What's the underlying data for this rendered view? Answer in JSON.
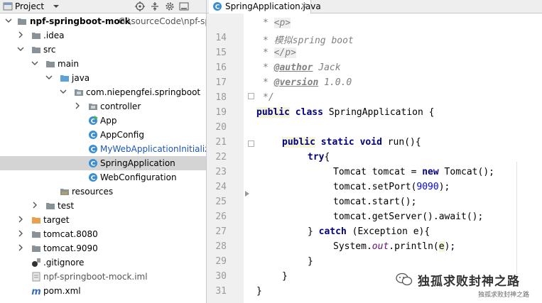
{
  "project_panel": {
    "title": "Project",
    "tree": [
      {
        "label": "npf-springboot-mock",
        "path": "G:\\sourceCode\\npf-springboot-mock",
        "icon": "folder-icon",
        "arrow": "expanded"
      },
      {
        "label": ".idea",
        "icon": "folder-icon",
        "arrow": "collapsed"
      },
      {
        "label": "src",
        "icon": "folder-icon",
        "arrow": "expanded"
      },
      {
        "label": "main",
        "icon": "folder-icon",
        "arrow": "expanded"
      },
      {
        "label": "java",
        "icon": "source-folder-icon",
        "arrow": "expanded"
      },
      {
        "label": "com.niepengfei.springboot",
        "icon": "package-icon",
        "arrow": "expanded"
      },
      {
        "label": "controller",
        "icon": "package-icon",
        "arrow": "collapsed"
      },
      {
        "label": "App",
        "icon": "runnable-class-icon",
        "arrow": "none"
      },
      {
        "label": "AppConfig",
        "icon": "class-icon",
        "arrow": "none"
      },
      {
        "label": "MyWebApplicationInitializer",
        "icon": "class-icon",
        "arrow": "none",
        "color": "#1a57b8"
      },
      {
        "label": "SpringApplication",
        "icon": "class-icon",
        "arrow": "none",
        "selected": true
      },
      {
        "label": "WebConfiguration",
        "icon": "class-icon",
        "arrow": "none"
      },
      {
        "label": "resources",
        "icon": "resources-folder-icon",
        "arrow": "none"
      },
      {
        "label": "test",
        "icon": "folder-icon",
        "arrow": "collapsed"
      },
      {
        "label": "target",
        "icon": "excluded-folder-icon",
        "arrow": "collapsed"
      },
      {
        "label": "tomcat.8080",
        "icon": "folder-icon",
        "arrow": "collapsed"
      },
      {
        "label": "tomcat.9090",
        "icon": "folder-icon",
        "arrow": "collapsed"
      },
      {
        "label": ".gitignore",
        "icon": "gitignore-icon",
        "arrow": "none"
      },
      {
        "label": "npf-springboot-mock.iml",
        "icon": "iml-file-icon",
        "arrow": "none",
        "color": "#555555"
      },
      {
        "label": "pom.xml",
        "icon": "maven-icon",
        "arrow": "none"
      }
    ]
  },
  "editor": {
    "tab_label": "SpringApplication.java",
    "line_numbers": [
      "14",
      "15",
      "16",
      "17",
      "18",
      "19",
      "20",
      "21",
      "22",
      "23",
      "24",
      "25",
      "26",
      "27",
      "28",
      "29",
      "30",
      "31"
    ],
    "code": {
      "l13": "* ",
      "l13_tag": "<p>",
      "l14": "* 模拟",
      "l14_b": "spring boot",
      "l15": "* ",
      "l15_tag": "</p>",
      "l16": "* ",
      "l16_tag": "@author",
      "l16_b": " Jack",
      "l17": "* ",
      "l17_tag": "@version",
      "l17_b": " 1.0.0",
      "l18": "*/",
      "l19_kw1": "public",
      "l19_kw2": "class",
      "l19_rest": " SpringApplication {",
      "l21_kw1": "public",
      "l21_kw2": "static",
      "l21_kw3": "void",
      "l21_rest": " run(){",
      "l22_kw": "try",
      "l22_rest": "{",
      "l23_a": "Tomcat tomcat = ",
      "l23_kw": "new",
      "l23_b": " Tomcat();",
      "l24_a": "tomcat.setPort(",
      "l24_num": "9090",
      "l24_b": ");",
      "l25": "tomcat.start();",
      "l26": "tomcat.getServer().await();",
      "l27_a": "} ",
      "l27_kw": "catch",
      "l27_b": " (Exception e){",
      "l28_a": "System.",
      "l28_fld": "out",
      "l28_b": ".println(",
      "l28_e": "e",
      "l28_c": ");",
      "l29": "}",
      "l30": "}",
      "l31": "}"
    }
  },
  "watermark": {
    "title": "独孤求败封神之路",
    "subtitle": "独孤求败封神之路"
  },
  "colors": {
    "selection": "#d4d4d4",
    "keyword": "#000080",
    "number": "#0000ff",
    "comment": "#808080",
    "gutter": "#f0f0f0"
  }
}
